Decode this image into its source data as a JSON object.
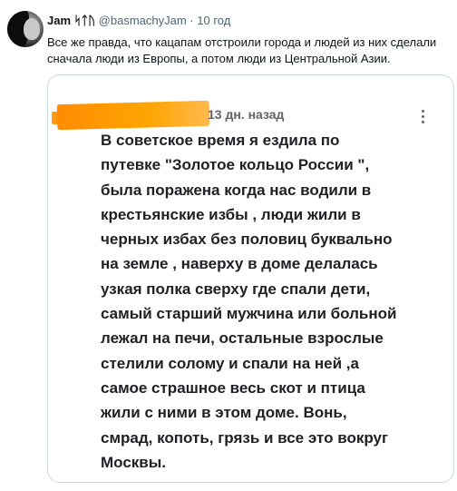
{
  "tweet": {
    "author_name": "Jam ᛋᛏᚢ",
    "handle": "@basmachyJam",
    "separator": "·",
    "time": "10 год",
    "text": "Все же правда, что кацапам отстроили города и людей из них сделали сначала люди из Европы, а потом люди из Центральной Азии."
  },
  "quoted_comment": {
    "time_ago": "13 дн. назад",
    "menu_icon": "more-vertical-icon",
    "body": "В советское время я ездила по\nпутевке \"Золотое кольцо России \",\nбыла поражена когда нас водили в\nкрестьянские избы , люди жили  в\nчерных избах без половиц буквально\nна земле  , наверху в доме делалась\nузкая  полка сверху  где спали дети,\nсамый старший мужчина или больной\nлежал на печи, остальные взрослые\nстелили солому и спали на ней ,а\nсамое страшное весь скот и птица\nжили с ними в этом доме. Вонь,\nсмрад, копоть, грязь и все это вокруг\nМосквы."
  },
  "colors": {
    "redaction": "#ff9a10",
    "border": "#cfd9de",
    "muted_text": "#536471"
  }
}
